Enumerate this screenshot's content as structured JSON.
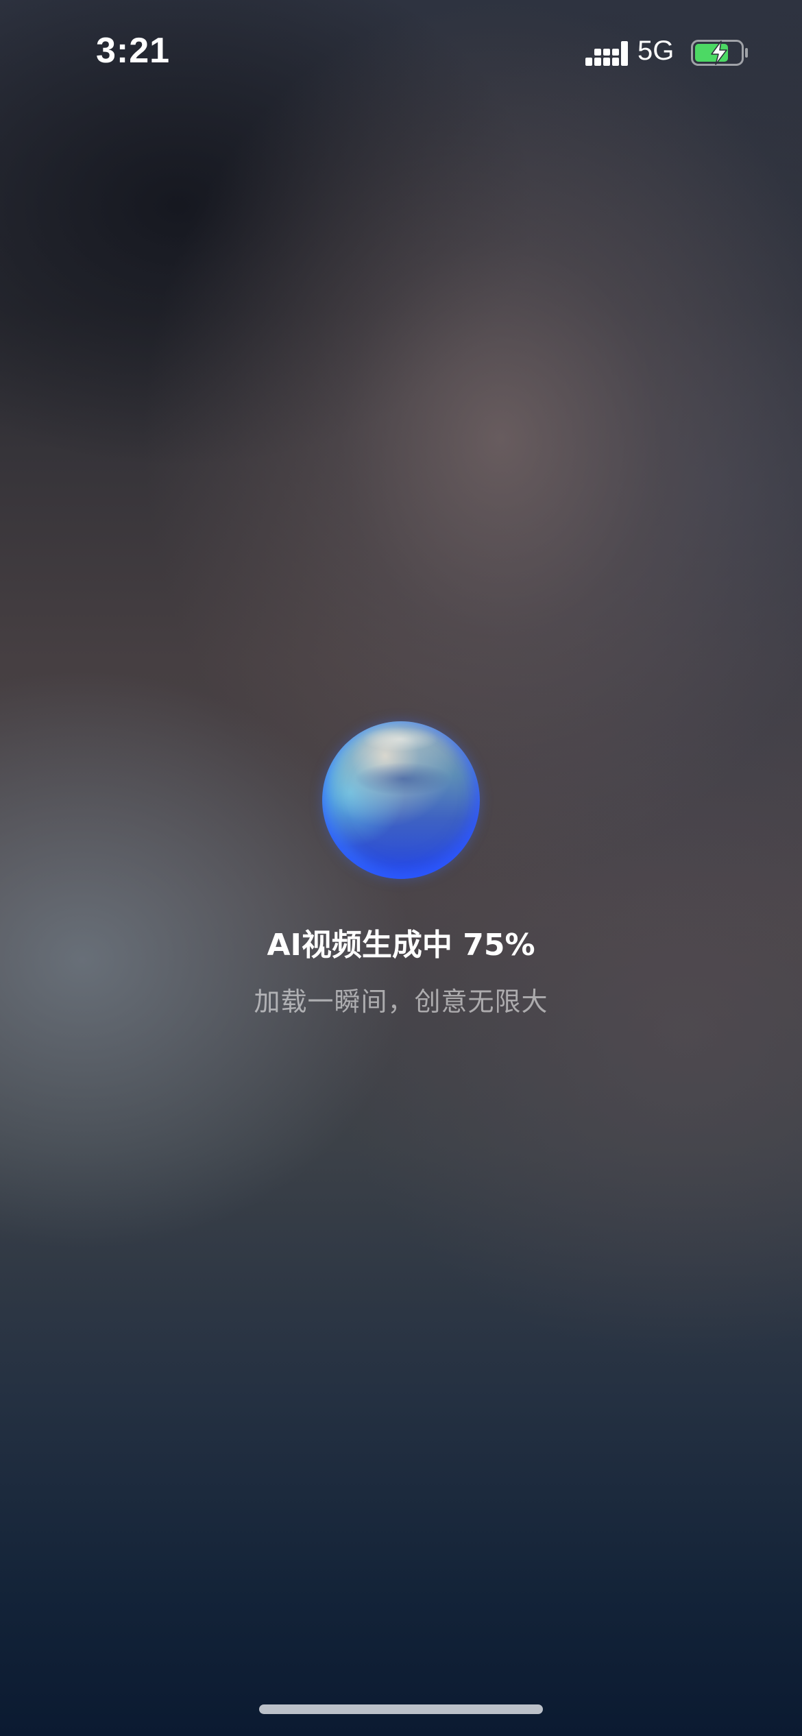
{
  "status_bar": {
    "time": "3:21",
    "network": "5G",
    "signal_icon": "cellular-signal-icon",
    "battery_icon": "battery-charging-icon",
    "battery_color": "#4cd964"
  },
  "loading": {
    "orb_icon": "ai-orb-icon",
    "progress_percent": 75,
    "title": "AI视频生成中 75%",
    "subtitle": "加载一瞬间，创意无限大",
    "accent_color": "#2546e0"
  }
}
